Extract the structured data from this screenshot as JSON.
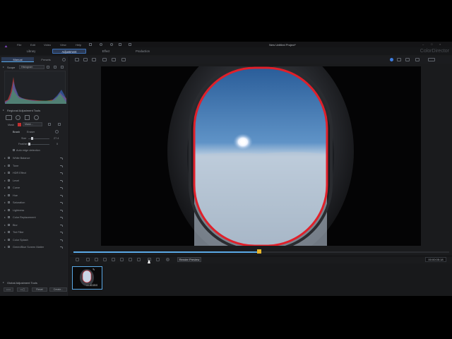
{
  "menu": {
    "items": [
      "File",
      "Edit",
      "Video",
      "View",
      "Help"
    ]
  },
  "window_title": "New Untitled Project*",
  "modes": [
    "Library",
    "Adjustment",
    "Effect",
    "Production"
  ],
  "active_mode": "Adjustment",
  "brand": "ColorDirector",
  "left_tabs": {
    "manual": "Manual",
    "presets": "Presets"
  },
  "scope": {
    "label": "Scope",
    "mode": "Histogram"
  },
  "regional": {
    "title": "Regional Adjustment Tools",
    "mask_label": "Mask",
    "mask_value": "Mask...",
    "tab_brush": "Brush",
    "tab_eraser": "Eraser",
    "size_label": "Size",
    "size_value": "27.4",
    "feather_label": "Feather",
    "feather_value": "0",
    "auto_edge": "Auto edge detection"
  },
  "adjustments": [
    "White Balance",
    "Tone",
    "HDR Effect",
    "Level",
    "Curve",
    "Hue",
    "Saturation",
    "Lightness",
    "Color Replacement",
    "Blur",
    "Tint Filter",
    "Color Splash",
    "Green/Blue Screen Matter"
  ],
  "global": {
    "title": "Global Adjustment Tools"
  },
  "bottom_buttons": {
    "reset": "Reset",
    "create": "Create..."
  },
  "render_preview": "Render Preview",
  "timecode": "00:00:05:18",
  "clip_time": "00:00:15:0",
  "playback_progress": 0.37,
  "colors": {
    "accent": "#5aa9e6",
    "mask": "#e0202a",
    "playhead": "#e8b52a"
  },
  "icons": [
    "app-logo-icon",
    "histogram-icon",
    "brush-icon",
    "eraser-icon",
    "undo-icon",
    "play-icon"
  ]
}
